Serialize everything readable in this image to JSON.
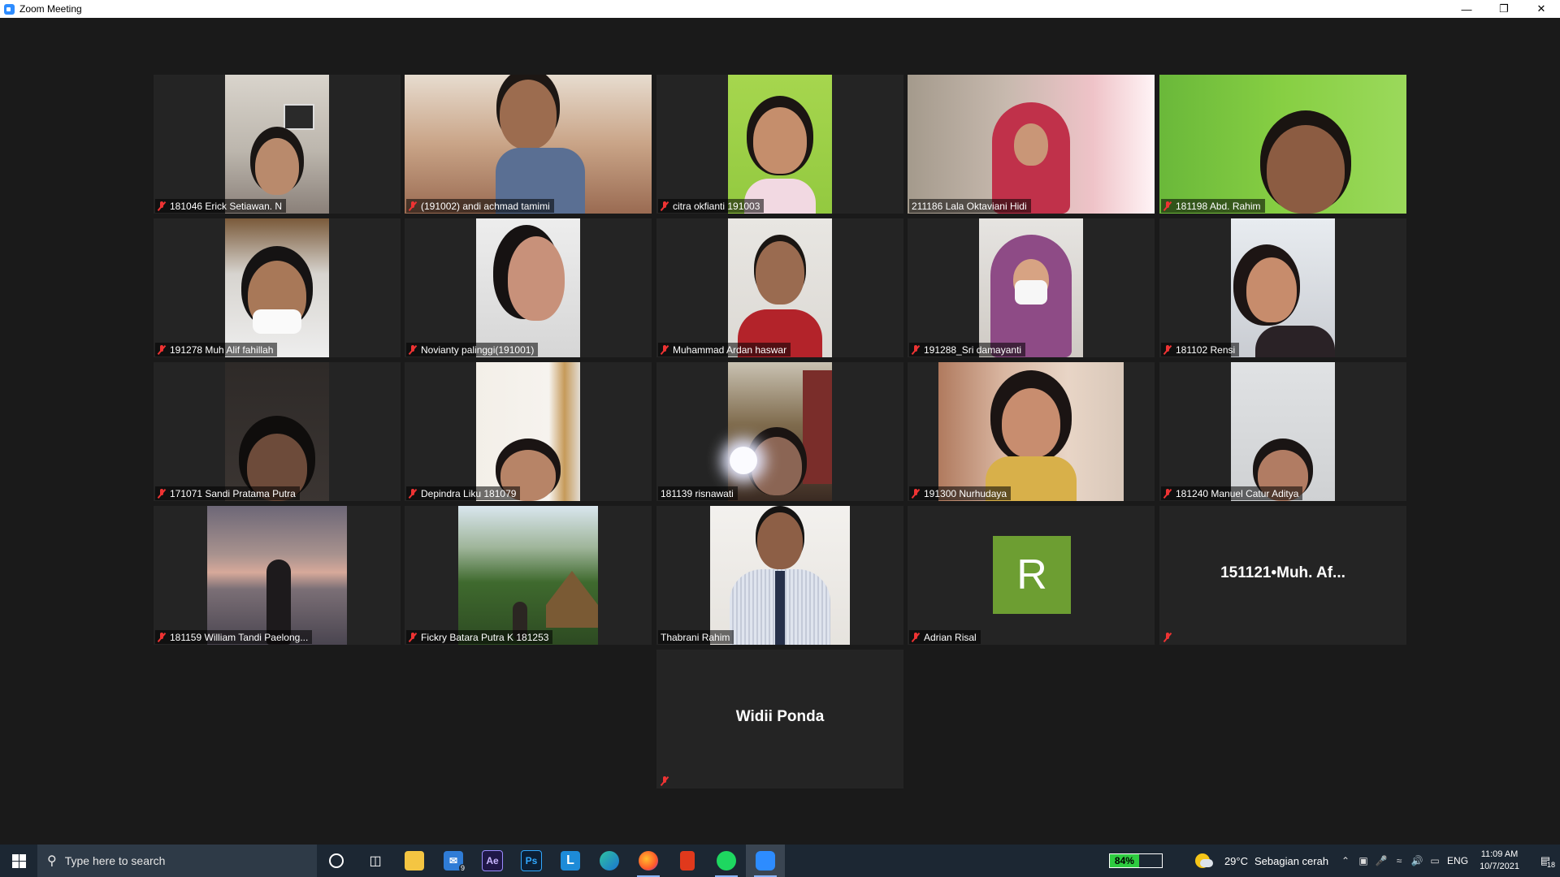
{
  "window": {
    "title": "Zoom Meeting"
  },
  "participants": [
    {
      "name": "181046 Erick Setiawan. N",
      "muted": true
    },
    {
      "name": "(191002) andi achmad tamimi",
      "muted": true
    },
    {
      "name": "citra okfianti 191003",
      "muted": true
    },
    {
      "name": "211186 Lala Oktaviani Hidi",
      "muted": false,
      "active_speaker": true
    },
    {
      "name": "181198 Abd. Rahim",
      "muted": true
    },
    {
      "name": "191278 Muh Alif fahillah",
      "muted": true
    },
    {
      "name": "Novianty palinggi(191001)",
      "muted": true
    },
    {
      "name": "Muhammad Ardan haswar",
      "muted": true
    },
    {
      "name": "191288_Sri damayanti",
      "muted": true
    },
    {
      "name": "181102 Rensi",
      "muted": true
    },
    {
      "name": "171071 Sandi Pratama Putra",
      "muted": true
    },
    {
      "name": "Depindra Liku 181079",
      "muted": true
    },
    {
      "name": "181139 risnawati",
      "muted": false
    },
    {
      "name": "191300 Nurhudaya",
      "muted": true
    },
    {
      "name": "181240 Manuel Catur Aditya",
      "muted": true
    },
    {
      "name": "181159 William Tandi Paelong...",
      "muted": true
    },
    {
      "name": "Fickry Batara Putra K 181253",
      "muted": true
    },
    {
      "name": "Thabrani Rahim",
      "muted": false
    },
    {
      "name": "Adrian Risal",
      "muted": true,
      "avatar_letter": "R",
      "avatar_color": "#6d9e32"
    },
    {
      "name": "",
      "muted": true,
      "display_name": "151121•Muh.  Af..."
    },
    {
      "name": "",
      "muted": true,
      "display_name": "Widii Ponda"
    }
  ],
  "taskbar": {
    "search_placeholder": "Type here to search",
    "apps": [
      {
        "icon": "cortana-icon"
      },
      {
        "icon": "task-view-icon"
      },
      {
        "icon": "file-explorer-icon"
      },
      {
        "icon": "mail-icon",
        "badge": "9"
      },
      {
        "icon": "after-effects-icon",
        "label": "Ae"
      },
      {
        "icon": "photoshop-icon",
        "label": "Ps"
      },
      {
        "icon": "l-app-icon",
        "label": "L"
      },
      {
        "icon": "edge-icon"
      },
      {
        "icon": "firefox-icon"
      },
      {
        "icon": "office-icon"
      },
      {
        "icon": "spotify-icon"
      },
      {
        "icon": "zoom-icon"
      }
    ],
    "battery": "84%",
    "weather_temp": "29°C",
    "weather_text": "Sebagian cerah",
    "language": "ENG",
    "time": "11:09 AM",
    "date": "10/7/2021",
    "notifications": "18"
  }
}
